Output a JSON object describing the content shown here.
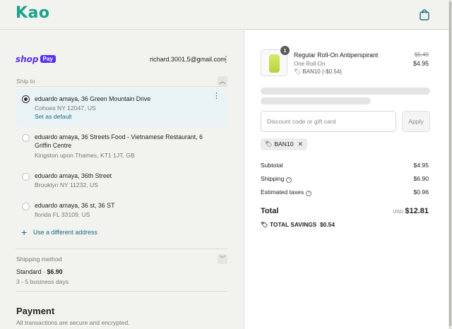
{
  "header": {
    "logo": "Kao",
    "bag_icon": "shopping-bag-icon"
  },
  "express": {
    "brand_shop": "shop",
    "brand_pay": "Pay",
    "email": "richard.3001.5@gmail.com"
  },
  "ship_to": {
    "label": "Ship to",
    "addresses": [
      {
        "line1": "eduardo amaya, 36 Green Mountain Drive",
        "line2": "Cohoes NY 12047, US",
        "default_label": "Set as default",
        "selected": true
      },
      {
        "line1": "eduardo amaya, 36 Streets Food - Vietnamese Restaurant, 6 Griffin Centre",
        "line2": "Kingston upon Thames, KT1 1JT, GB"
      },
      {
        "line1": "eduardo amaya, 36th Street",
        "line2": "Brooklyn NY 11232, US"
      },
      {
        "line1": "eduardo amaya, 36 st, 36 ST",
        "line2": "florida FL 33109, US"
      }
    ],
    "use_different": "Use a different address"
  },
  "shipping_method": {
    "label": "Shipping method",
    "name": "Standard",
    "price": "$6.90",
    "days": "3 - 5 business days"
  },
  "payment": {
    "title": "Payment",
    "subtitle": "All transactions are secure and encrypted."
  },
  "order": {
    "item": {
      "quantity": "1",
      "name": "Regular Roll-On Antiperspirant",
      "variant": "One Roll-On",
      "discount": "BAN10 (-$0.54)",
      "old_price": "$5.49",
      "price": "$4.95"
    },
    "discount_placeholder": "Discount code or gift card",
    "apply_label": "Apply",
    "applied_code": "BAN10",
    "subtotal_label": "Subtotal",
    "subtotal": "$4.95",
    "shipping_label": "Shipping",
    "shipping": "$6.90",
    "taxes_label": "Estimated taxes",
    "taxes": "$0.96",
    "total_label": "Total",
    "currency": "USD",
    "total": "$12.81",
    "savings_label": "TOTAL SAVINGS",
    "savings": "$0.54"
  },
  "colors": {
    "brand": "#1aa28c",
    "shop_pay": "#5a31f4",
    "link": "#136c8c"
  }
}
